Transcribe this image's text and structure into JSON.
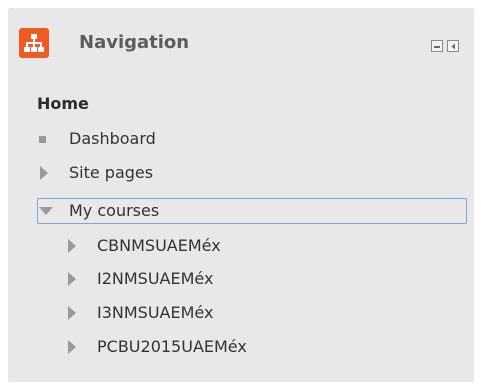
{
  "block": {
    "title": "Navigation",
    "icon": "sitemap-icon",
    "accent_color": "#f05b22"
  },
  "controls": {
    "minimize": "minimize-icon",
    "dock": "dock-icon"
  },
  "tree": {
    "home_label": "Home",
    "dashboard_label": "Dashboard",
    "site_pages_label": "Site pages",
    "my_courses_label": "My courses",
    "courses": [
      {
        "label": "CBNMSUAEMéx"
      },
      {
        "label": "I2NMSUAEMéx"
      },
      {
        "label": "I3NMSUAEMéx"
      },
      {
        "label": "PCBU2015UAEMéx"
      }
    ]
  }
}
